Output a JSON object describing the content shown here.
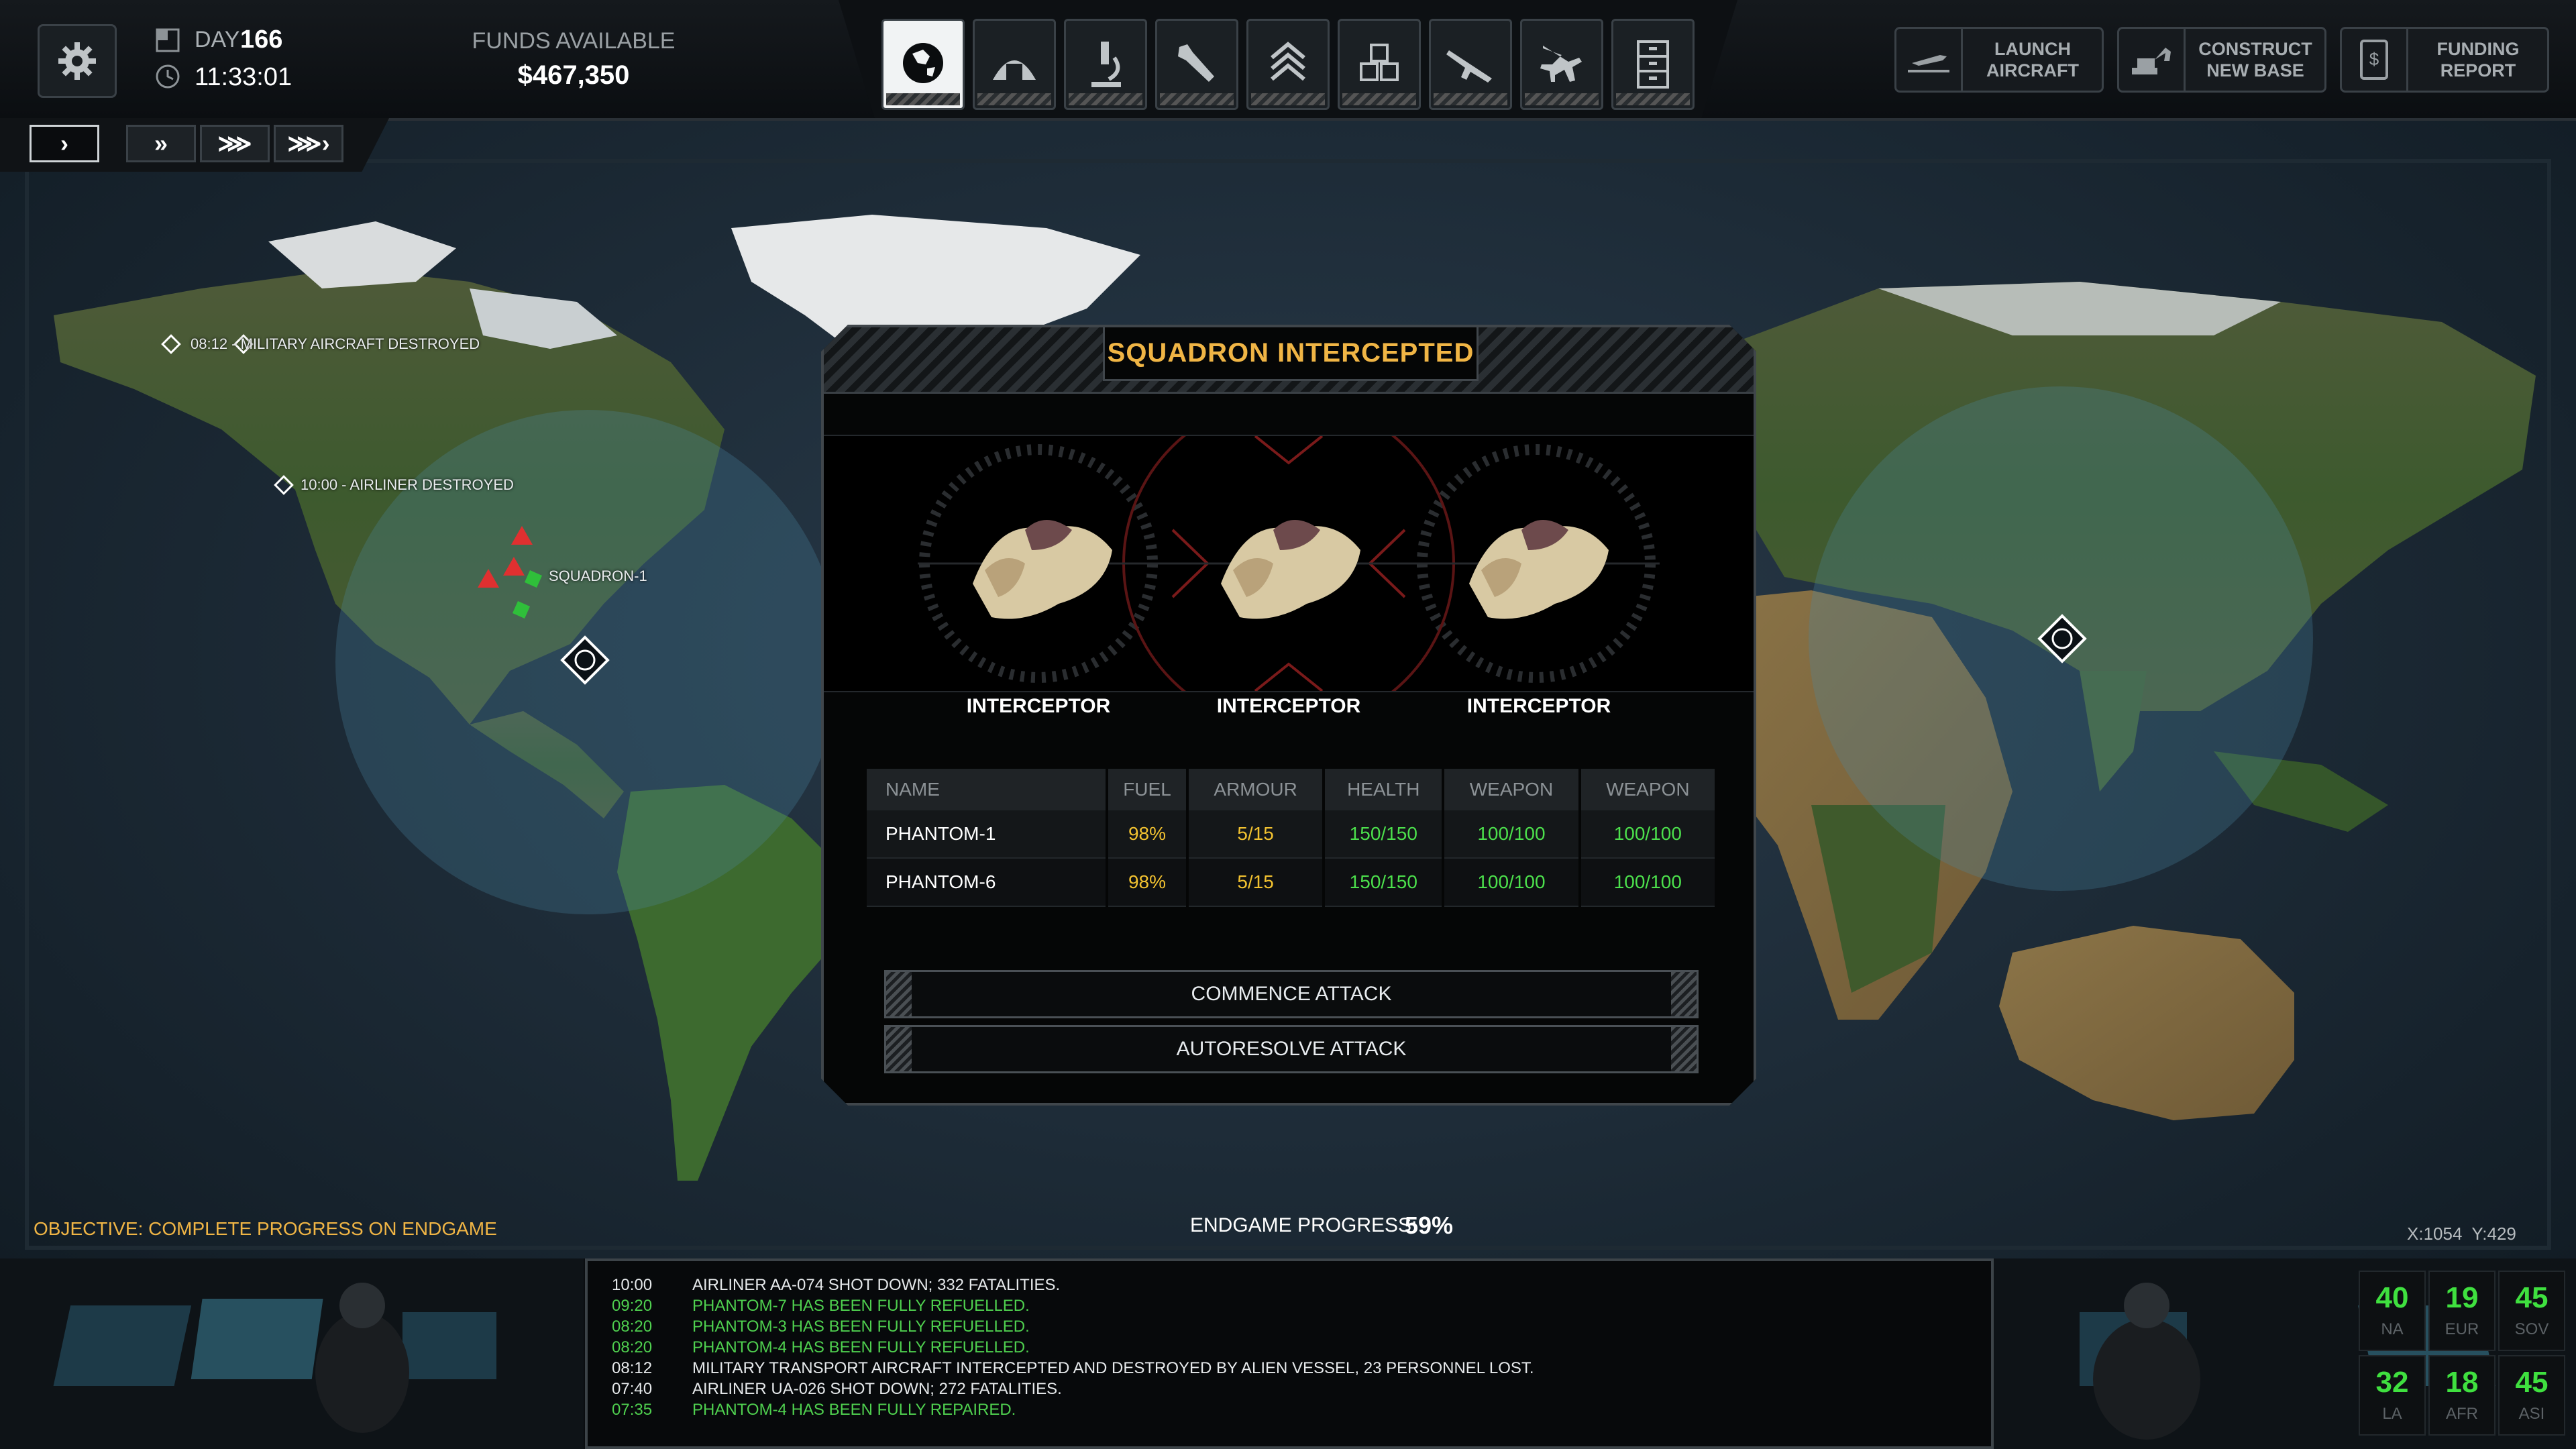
{
  "topbar": {
    "day_label": "DAY",
    "day_value": "166",
    "time": "11:33:01",
    "funds_label": "FUNDS AVAILABLE",
    "funds_value": "$467,350",
    "nav": [
      {
        "name": "geoscape",
        "icon": "globe-icon",
        "active": true
      },
      {
        "name": "base",
        "icon": "hangar-icon"
      },
      {
        "name": "research",
        "icon": "microscope-icon"
      },
      {
        "name": "engineering",
        "icon": "wrench-icon"
      },
      {
        "name": "soldiers",
        "icon": "chevron-rank-icon"
      },
      {
        "name": "stores",
        "icon": "crates-icon"
      },
      {
        "name": "equipment",
        "icon": "rifle-icon"
      },
      {
        "name": "aircraft",
        "icon": "jet-icon"
      },
      {
        "name": "archives",
        "icon": "cabinet-icon"
      }
    ],
    "actions": [
      {
        "label": "LAUNCH\nAIRCRAFT",
        "icon": "jet-launch-icon"
      },
      {
        "label": "CONSTRUCT\nNEW BASE",
        "icon": "excavator-icon"
      },
      {
        "label": "FUNDING\nREPORT",
        "icon": "document-dollar-icon"
      }
    ]
  },
  "speed": [
    "›",
    "»",
    "⋙",
    "⋙›"
  ],
  "map_labels": {
    "event1": "08:12 - MILITARY AIRCRAFT DESTROYED",
    "event2": "10:00 - AIRLINER DESTROYED",
    "squadron": "SQUADRON-1",
    "objective": "OBJECTIVE: COMPLETE PROGRESS ON ENDGAME",
    "endgame_label": "ENDGAME PROGRESS:",
    "endgame_value": "59%",
    "coords": "X:1054  Y:429"
  },
  "dialog": {
    "title": "SQUADRON INTERCEPTED",
    "units": [
      "INTERCEPTOR",
      "INTERCEPTOR",
      "INTERCEPTOR"
    ],
    "headers": [
      "NAME",
      "FUEL",
      "ARMOUR",
      "HEALTH",
      "WEAPON",
      "WEAPON"
    ],
    "rows": [
      [
        "PHANTOM-1",
        "98%",
        "5/15",
        "150/150",
        "100/100",
        "100/100"
      ],
      [
        "PHANTOM-6",
        "98%",
        "5/15",
        "150/150",
        "100/100",
        "100/100"
      ]
    ],
    "commence": "COMMENCE ATTACK",
    "autoresolve": "AUTORESOLVE ATTACK"
  },
  "feed": [
    {
      "time": "10:00",
      "text": "AIRLINER AA-074 SHOT DOWN; 332 FATALITIES.",
      "color": "#e6e9eb"
    },
    {
      "time": "09:20",
      "text": "PHANTOM-7 HAS BEEN FULLY REFUELLED.",
      "color": "#4fd04f"
    },
    {
      "time": "08:20",
      "text": "PHANTOM-3 HAS BEEN FULLY REFUELLED.",
      "color": "#4fd04f"
    },
    {
      "time": "08:20",
      "text": "PHANTOM-4 HAS BEEN FULLY REFUELLED.",
      "color": "#4fd04f"
    },
    {
      "time": "08:12",
      "text": "MILITARY TRANSPORT AIRCRAFT INTERCEPTED AND DESTROYED BY ALIEN VESSEL, 23 PERSONNEL LOST.",
      "color": "#e6e9eb"
    },
    {
      "time": "07:40",
      "text": "AIRLINER UA-026 SHOT DOWN; 272 FATALITIES.",
      "color": "#e6e9eb"
    },
    {
      "time": "07:35",
      "text": "PHANTOM-4 HAS BEEN FULLY REPAIRED.",
      "color": "#4fd04f"
    }
  ],
  "panic": [
    {
      "value": "40",
      "region": "NA"
    },
    {
      "value": "19",
      "region": "EUR"
    },
    {
      "value": "45",
      "region": "SOV"
    },
    {
      "value": "32",
      "region": "LA"
    },
    {
      "value": "18",
      "region": "AFR"
    },
    {
      "value": "45",
      "region": "ASI"
    }
  ]
}
